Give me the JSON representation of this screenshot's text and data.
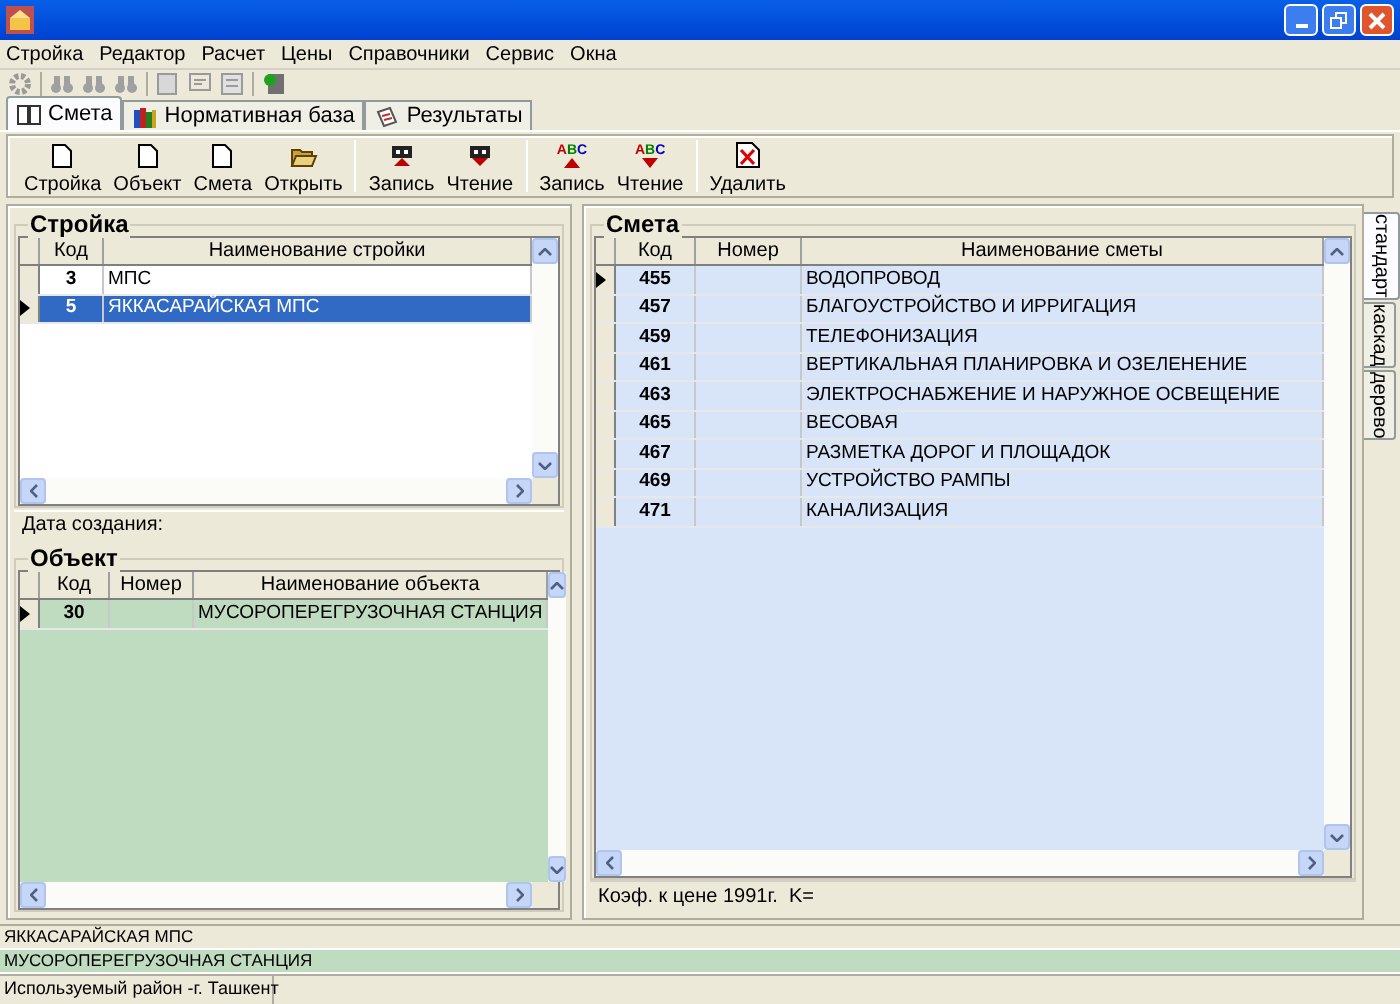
{
  "menu": [
    "Стройка",
    "Редактор",
    "Расчет",
    "Цены",
    "Справочники",
    "Сервис",
    "Окна"
  ],
  "tabs": [
    {
      "label": "Смета",
      "kind": "book",
      "selected": true
    },
    {
      "label": "Нормативная база",
      "kind": "books",
      "selected": false
    },
    {
      "label": "Результаты",
      "kind": "chart",
      "selected": false
    }
  ],
  "actions": [
    {
      "label": "Стройка",
      "kind": "document",
      "separator_before": false
    },
    {
      "label": "Объект",
      "kind": "document",
      "separator_before": false
    },
    {
      "label": "Смета",
      "kind": "document",
      "separator_before": false
    },
    {
      "label": "Открыть",
      "kind": "folder",
      "separator_before": false
    },
    {
      "label": "Запись",
      "kind": "save",
      "separator_before": true
    },
    {
      "label": "Чтение",
      "kind": "load",
      "separator_before": false
    },
    {
      "label": "Запись",
      "kind": "text_save",
      "icon_text": "ABC",
      "separator_before": true
    },
    {
      "label": "Чтение",
      "kind": "text_load",
      "icon_text": "ABC",
      "separator_before": false
    },
    {
      "label": "Удалить",
      "kind": "delete",
      "separator_before": true
    }
  ],
  "stroika": {
    "title": "Стройка",
    "columns": [
      "Код",
      "Наименование стройки"
    ],
    "rows": [
      {
        "code": "3",
        "name": "МПС",
        "selected": false
      },
      {
        "code": "5",
        "name": "ЯККАСАРАЙСКАЯ МПС",
        "selected": true
      }
    ],
    "created_label": "Дата создания:"
  },
  "object": {
    "title": "Объект",
    "columns": [
      "Код",
      "Номер",
      "Наименование объекта"
    ],
    "rows": [
      {
        "code": "30",
        "name": "МУСОРОПЕРЕГРУЗОЧНАЯ СТАНЦИЯ",
        "selected": true
      }
    ]
  },
  "smeta": {
    "title": "Смета",
    "columns": [
      "Код",
      "Номер",
      "Наименование сметы"
    ],
    "rows": [
      {
        "code": "455",
        "name": "ВОДОПРОВОД",
        "selected": true
      },
      {
        "code": "457",
        "name": "БЛАГОУСТРОЙСТВО И ИРРИГАЦИЯ",
        "selected": false
      },
      {
        "code": "459",
        "name": "ТЕЛЕФОНИЗАЦИЯ",
        "selected": false
      },
      {
        "code": "461",
        "name": "ВЕРТИКАЛЬНАЯ ПЛАНИРОВКА И ОЗЕЛЕНЕНИЕ",
        "selected": false
      },
      {
        "code": "463",
        "name": "ЭЛЕКТРОСНАБЖЕНИЕ И НАРУЖНОЕ ОСВЕЩЕНИЕ",
        "selected": false
      },
      {
        "code": "465",
        "name": "ВЕСОВАЯ",
        "selected": false
      },
      {
        "code": "467",
        "name": "РАЗМЕТКА ДОРОГ И ПЛОЩАДОК",
        "selected": false
      },
      {
        "code": "469",
        "name": "УСТРОЙСТВО РАМПЫ",
        "selected": false
      },
      {
        "code": "471",
        "name": "КАНАЛИЗАЦИЯ",
        "selected": false
      }
    ],
    "footer": "Коэф. к цене 1991г.  K="
  },
  "side_tabs": [
    {
      "label": "стандарт",
      "selected": true
    },
    {
      "label": "каскад",
      "selected": false
    },
    {
      "label": "дерево",
      "selected": false
    }
  ],
  "info_lines": [
    {
      "text": "ЯККАСАРАЙСКАЯ МПС",
      "color": "#ece9d8"
    },
    {
      "text": "МУСОРОПЕРЕГРУЗОЧНАЯ СТАНЦИЯ",
      "color": "#c0dcc0"
    }
  ],
  "status_bar": [
    "Используемый район -г. Ташкент"
  ]
}
